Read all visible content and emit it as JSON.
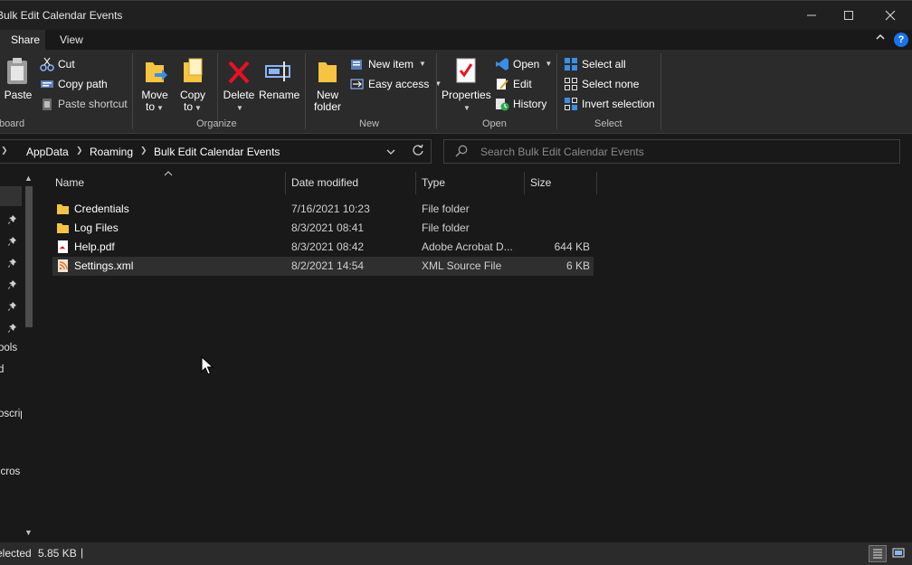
{
  "window": {
    "title": "Bulk Edit Calendar Events",
    "minimize_label": "—",
    "maximize_label": "☐",
    "close_label": "✕"
  },
  "tabs": {
    "share": "Share",
    "view": "View",
    "collapse": "⌃",
    "help": "?"
  },
  "ribbon": {
    "clipboard": {
      "label": "Clipboard",
      "paste": "Paste",
      "cut": "Cut",
      "copy_path": "Copy path",
      "paste_shortcut": "Paste shortcut"
    },
    "organize": {
      "label": "Organize",
      "move_to_1": "Move",
      "move_to_2": "to",
      "copy_to_1": "Copy",
      "copy_to_2": "to",
      "delete": "Delete",
      "rename": "Rename"
    },
    "new": {
      "label": "New",
      "new_folder_1": "New",
      "new_folder_2": "folder",
      "new_item": "New item",
      "easy_access": "Easy access"
    },
    "open": {
      "label": "Open",
      "properties": "Properties",
      "open": "Open",
      "edit": "Edit",
      "history": "History"
    },
    "select": {
      "label": "Select",
      "select_all": "Select all",
      "select_none": "Select none",
      "invert_selection": "Invert selection"
    }
  },
  "address": {
    "crumbs": [
      "AppData",
      "Roaming",
      "Bulk Edit Calendar Events"
    ],
    "search_placeholder": "Search Bulk Edit Calendar Events"
  },
  "nav": {
    "items": [
      "ools",
      "d",
      "oscrip",
      "icros"
    ]
  },
  "columns": {
    "name": "Name",
    "date": "Date modified",
    "type": "Type",
    "size": "Size"
  },
  "files": [
    {
      "name": "Credentials",
      "date": "7/16/2021 10:23",
      "type": "File folder",
      "size": "",
      "icon": "folder-icon"
    },
    {
      "name": "Log Files",
      "date": "8/3/2021 08:41",
      "type": "File folder",
      "size": "",
      "icon": "folder-icon"
    },
    {
      "name": "Help.pdf",
      "date": "8/3/2021 08:42",
      "type": "Adobe Acrobat D...",
      "size": "644 KB",
      "icon": "pdf-icon"
    },
    {
      "name": "Settings.xml",
      "date": "8/2/2021 14:54",
      "type": "XML Source File",
      "size": "6 KB",
      "icon": "xml-icon"
    }
  ],
  "status": {
    "selected_text": "elected",
    "selected_size": "5.85 KB",
    "cursor": "|"
  },
  "colors": {
    "accent": "#1a73e8",
    "delete_red": "#e81123",
    "folder_yellow": "#f6c343"
  }
}
